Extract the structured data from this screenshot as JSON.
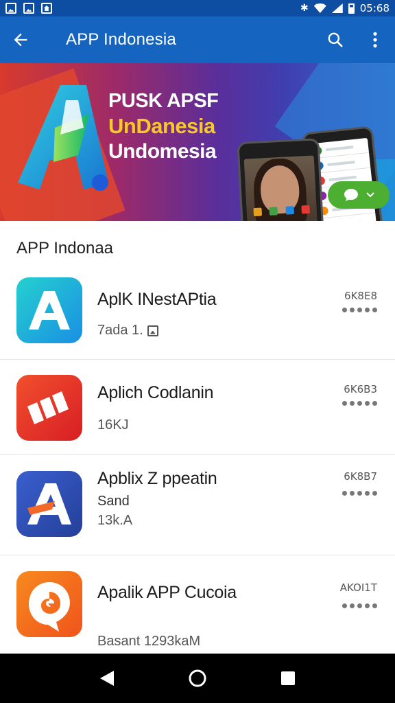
{
  "status_bar": {
    "time": "05:68",
    "icons": [
      "image-icon",
      "image-icon",
      "home-icon",
      "bluetooth-icon",
      "wifi-icon",
      "signal-icon",
      "battery-icon"
    ],
    "color": "#0d4ea3"
  },
  "app_bar": {
    "title": "APP Indonesia",
    "back_icon": "arrow-back-icon",
    "search_icon": "search-icon",
    "menu_icon": "more-vert-icon",
    "color": "#1565c0"
  },
  "banner": {
    "line1": "PUSK APSF",
    "line2": "UnDanesia",
    "line3": "Undomesia",
    "logo_icon": "letter-a-logo",
    "chat_icon": "chat-bubble-icon",
    "accent": "#f7c82c"
  },
  "section": {
    "title": "APP Indonaa"
  },
  "apps": [
    {
      "name": "AplK INestAPtia",
      "sub": "",
      "meta": "7ada 1.",
      "meta_icon": "image-icon",
      "size": "6K8E8",
      "icon": "letter-a-icon",
      "color": "#17c1d6"
    },
    {
      "name": "Aplich Codlanin",
      "sub": "",
      "meta": "16KJ",
      "meta_icon": "",
      "size": "6K6B3",
      "icon": "stripes-icon",
      "color": "#e52d26"
    },
    {
      "name": "Apblix Z ppeatin",
      "sub": "Sand",
      "meta": "13k.A",
      "meta_icon": "",
      "size": "6K8B7",
      "icon": "letter-a-icon",
      "color": "#2e4fb0"
    },
    {
      "name": "Apalik APP Cucoia",
      "sub": "",
      "meta": "Basant 1293kaM",
      "meta_icon": "",
      "size": "AKOI1T",
      "icon": "swirl-icon",
      "color": "#f4681e"
    }
  ],
  "nav_bar": {
    "back_icon": "nav-back-icon",
    "home_icon": "nav-home-icon",
    "recents_icon": "nav-recents-icon"
  }
}
